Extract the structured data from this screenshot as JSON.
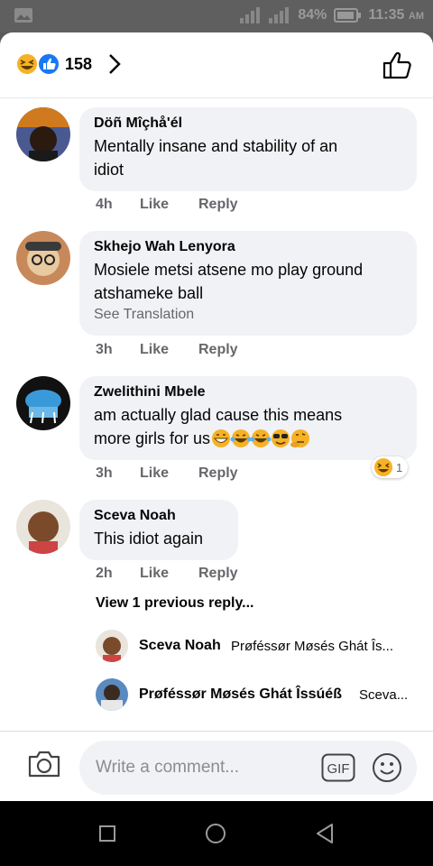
{
  "status_bar": {
    "battery": "84%",
    "time": "11:35",
    "ampm": "AM"
  },
  "reactions": {
    "count": "158"
  },
  "comments": [
    {
      "name": "Döñ Mîçhå'él",
      "text_lines": [
        "Mentally insane and stability of an",
        "idiot"
      ],
      "time": "4h",
      "like": "Like",
      "reply": "Reply"
    },
    {
      "name": "Skhejo Wah Lenyora",
      "text_lines": [
        "Mosiele metsi atsene mo  play ground",
        "atshameke ball"
      ],
      "see_translation": "See Translation",
      "time": "3h",
      "like": "Like",
      "reply": "Reply"
    },
    {
      "name": "Zwelithini Mbele",
      "text_lines": [
        "am actually glad cause this means",
        "more girls for us"
      ],
      "time": "3h",
      "like": "Like",
      "reply": "Reply",
      "reaction_count": "1"
    },
    {
      "name": "Sceva Noah",
      "text_lines": [
        "This idiot again"
      ],
      "time": "2h",
      "like": "Like",
      "reply": "Reply"
    }
  ],
  "view_previous": "View 1 previous reply...",
  "replies": [
    {
      "name": "Sceva Noah",
      "text": "Prøféssør Møsés Ghát Îs..."
    },
    {
      "name": "Prøféssør Møsés Ghát Îssúéß",
      "text": "Sceva..."
    }
  ],
  "composer": {
    "placeholder": "Write a comment...",
    "gif_label": "GIF"
  },
  "colors": {
    "haha": "#f7b125",
    "like_blue": "#1877f2",
    "meta_text": "#65676b",
    "bubble": "#f0f2f5"
  }
}
